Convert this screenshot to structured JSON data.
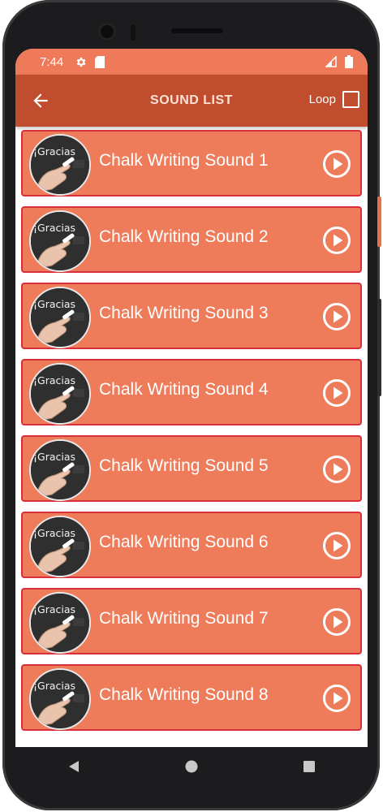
{
  "status_bar": {
    "time": "7:44",
    "left_icons": [
      "gear-icon",
      "sd-card-icon"
    ],
    "right_icons": [
      "signal-icon",
      "battery-icon"
    ]
  },
  "app_bar": {
    "back_icon": "arrow-left-icon",
    "title": "SOUND LIST",
    "loop_label": "Loop",
    "loop_checked": false
  },
  "sounds": [
    {
      "label": "Chalk Writing Sound 1",
      "thumb_text": "¡Gracias"
    },
    {
      "label": "Chalk Writing Sound 2",
      "thumb_text": "¡Gracias"
    },
    {
      "label": "Chalk Writing Sound 3",
      "thumb_text": "¡Gracias"
    },
    {
      "label": "Chalk Writing Sound 4",
      "thumb_text": "¡Gracias"
    },
    {
      "label": "Chalk Writing Sound 5",
      "thumb_text": "¡Gracias"
    },
    {
      "label": "Chalk Writing Sound 6",
      "thumb_text": "¡Gracias"
    },
    {
      "label": "Chalk Writing Sound 7",
      "thumb_text": "¡Gracias"
    },
    {
      "label": "Chalk Writing Sound 8",
      "thumb_text": "¡Gracias"
    }
  ],
  "nav_bar": {
    "icons": [
      "back-triangle-icon",
      "home-circle-icon",
      "recents-square-icon"
    ]
  },
  "colors": {
    "status_bar": "#ee7a5a",
    "app_bar": "#c14d2f",
    "item_background": "#ee7c5b",
    "item_border": "#d7303a",
    "phone_frame": "#1c1c1e"
  }
}
